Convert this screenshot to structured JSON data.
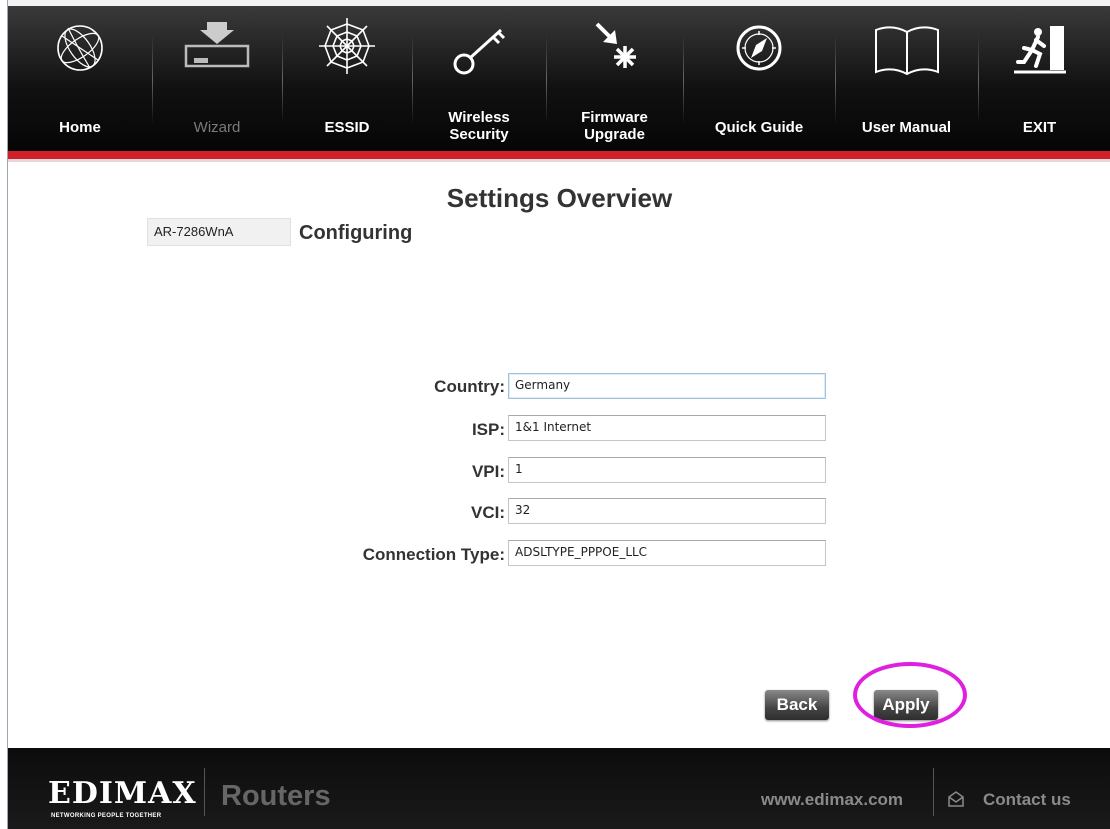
{
  "nav": {
    "items": [
      {
        "label": "Home",
        "icon": "globe-icon"
      },
      {
        "label": "Wizard",
        "icon": "download-device-icon"
      },
      {
        "label": "ESSID",
        "icon": "spiderweb-icon"
      },
      {
        "label_line1": "Wireless",
        "label_line2": "Security",
        "icon": "key-icon"
      },
      {
        "label_line1": "Firmware",
        "label_line2": "Upgrade",
        "icon": "firmware-arrow-icon"
      },
      {
        "label": "Quick Guide",
        "icon": "compass-icon"
      },
      {
        "label": "User Manual",
        "icon": "book-icon"
      },
      {
        "label": "EXIT",
        "icon": "exit-runner-icon"
      }
    ]
  },
  "page": {
    "title": "Settings Overview",
    "model": "AR-7286WnA",
    "status": "Configuring"
  },
  "form": {
    "country_label": "Country:",
    "country_value": "Germany",
    "isp_label": "ISP:",
    "isp_value": "1&1 Internet",
    "vpi_label": "VPI:",
    "vpi_value": "1",
    "vci_label": "VCI:",
    "vci_value": "32",
    "conn_label": "Connection Type:",
    "conn_value": "ADSLTYPE_PPPOE_LLC"
  },
  "buttons": {
    "back": "Back",
    "apply": "Apply"
  },
  "footer": {
    "logo": "EDIMAX",
    "tagline": "NETWORKING PEOPLE TOGETHER",
    "product": "Routers",
    "website": "www.edimax.com",
    "contact": "Contact us"
  },
  "colors": {
    "accent_red": "#d0202b",
    "highlight": "#e020e0"
  }
}
